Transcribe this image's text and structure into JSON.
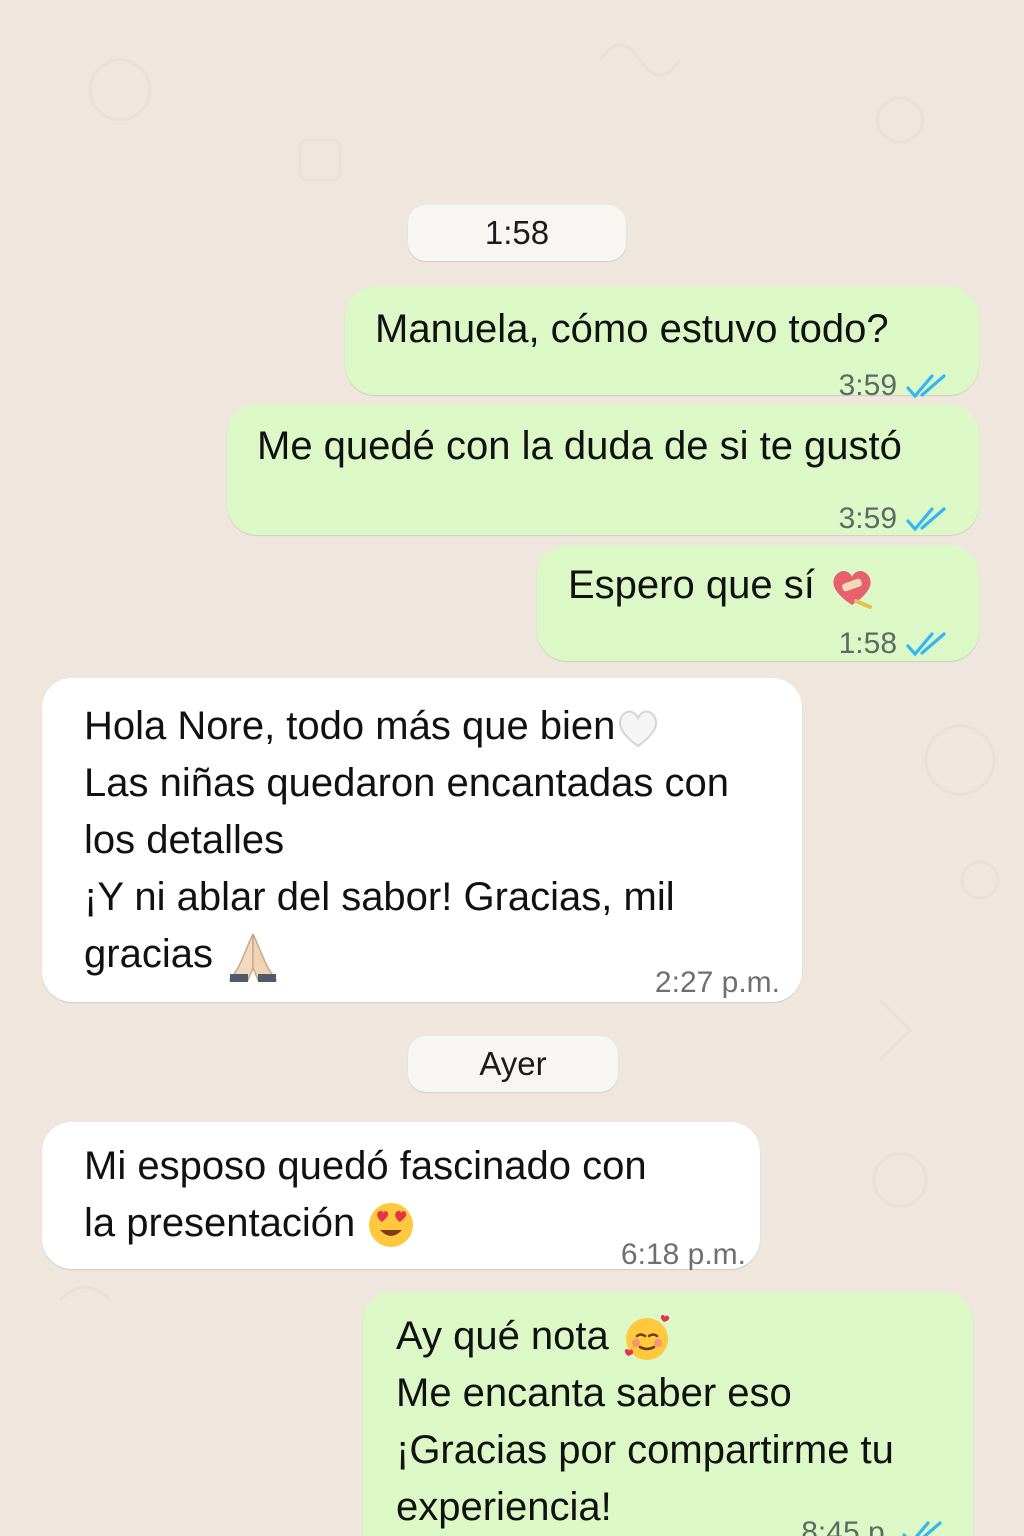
{
  "colors": {
    "background": "#EFE7DD",
    "outgoing_bubble": "#DCF8C6",
    "incoming_bubble": "#FFFFFF",
    "date_pill": "#F8F6F2",
    "read_ticks": "#34B7F1"
  },
  "dividers": {
    "first": "1:58",
    "second": "Ayer"
  },
  "messages": [
    {
      "direction": "outgoing",
      "lines": [
        "Manuela, cómo estuvo todo?"
      ],
      "time": "3:59",
      "status_icon": "double-check-read-icon"
    },
    {
      "direction": "outgoing",
      "lines": [
        "Me quedé con la duda de si te gustó"
      ],
      "time": "3:59",
      "status_icon": "double-check-read-icon"
    },
    {
      "direction": "outgoing",
      "lines": [
        "Espero que sí"
      ],
      "emoji": "heart-with-bandage-sticker-icon",
      "time": "1:58",
      "status_icon": "double-check-read-icon"
    },
    {
      "direction": "incoming",
      "lines": [
        "Hola Nore, todo más que bien",
        "Las niñas quedaron encantadas con",
        "los detalles",
        "¡Y ni ablar  del sabor! Gracias, mil",
        "gracias"
      ],
      "emojis": [
        "white-heart-icon",
        "praying-hands-icon"
      ],
      "time": "2:27 p.m."
    },
    {
      "direction": "incoming",
      "lines": [
        "Mi esposo quedó fascinado con",
        "la presentación"
      ],
      "emoji": "heart-eyes-face-icon",
      "time": "6:18 p.m."
    },
    {
      "direction": "outgoing",
      "lines": [
        "Ay qué nota",
        "Me encanta saber eso",
        "¡Gracias por compartirme tu",
        "experiencia!"
      ],
      "emoji": "face-with-hearts-icon",
      "time": "8:45 p.",
      "status_icon": "double-check-read-icon"
    }
  ]
}
